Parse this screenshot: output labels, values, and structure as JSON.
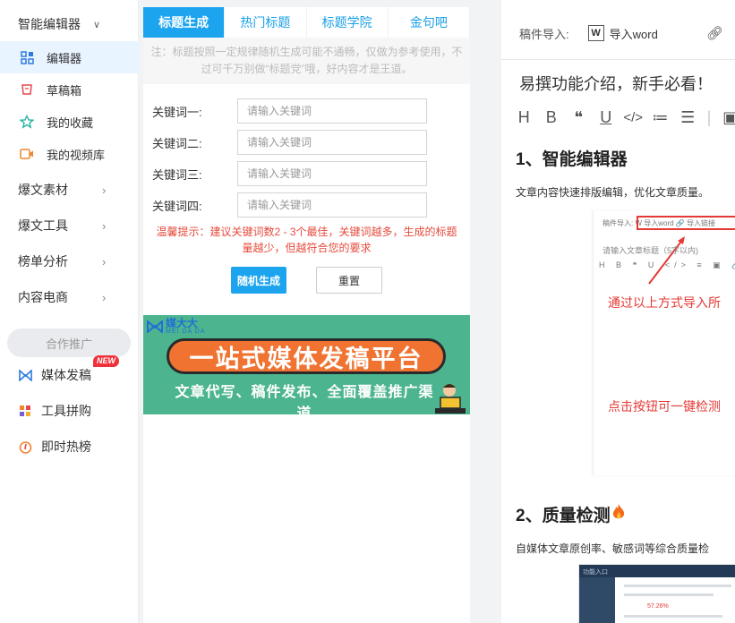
{
  "sidebar": {
    "head": "智能编辑器",
    "items": [
      {
        "label": "编辑器",
        "icon": "grid-icon"
      },
      {
        "label": "草稿箱",
        "icon": "draft-icon"
      },
      {
        "label": "我的收藏",
        "icon": "star-icon"
      },
      {
        "label": "我的视频库",
        "icon": "video-icon"
      }
    ],
    "groups": [
      "爆文素材",
      "爆文工具",
      "榜单分析",
      "内容电商"
    ],
    "promo_label": "合作推广",
    "external": [
      {
        "label": "媒体发稿",
        "icon": "media-icon",
        "badge": "NEW"
      },
      {
        "label": "工具拼购",
        "icon": "tools-icon"
      },
      {
        "label": "即时热榜",
        "icon": "hot-icon"
      }
    ]
  },
  "middle": {
    "tabs": [
      "标题生成",
      "热门标题",
      "标题学院",
      "金句吧"
    ],
    "note": "注：标题按照一定规律随机生成可能不通畅，仅做为参考使用，不过可千万别做“标题党”哦，好内容才是王道。",
    "keywords": [
      {
        "label": "关键词一:",
        "placeholder": "请输入关键词"
      },
      {
        "label": "关键词二:",
        "placeholder": "请输入关键词"
      },
      {
        "label": "关键词三:",
        "placeholder": "请输入关键词"
      },
      {
        "label": "关键词四:",
        "placeholder": "请输入关键词"
      }
    ],
    "tip": "温馨提示：建议关键词数2 - 3个最佳，关键词越多，生成的标题量越少，但越符合您的要求",
    "generate_label": "随机生成",
    "reset_label": "重置",
    "banner": {
      "logo": "媒大大",
      "logo_sub": "MEI DA DA",
      "headline": "一站式媒体发稿平台",
      "subline": "文章代写、稿件发布、全面覆盖推广渠道"
    }
  },
  "editor": {
    "import_label": "稿件导入:",
    "word_label": "导入word",
    "article_title": "易撰功能介绍，新手必看！",
    "toolbar": [
      "H",
      "B",
      "❝",
      "U",
      "</>",
      "≔",
      "☰",
      "|",
      "▣"
    ],
    "section1_title": "1、智能编辑器",
    "section1_text": "文章内容快速排版编辑，优化文章质量。",
    "shot1": {
      "top_text": "稿件导入:  W 导入word     🔗 导入链接",
      "title_hint": "请输入文章标题（5字以内)",
      "toolbar_text": "H B ❝ U </> ≡ ▣ 🔗",
      "callout1": "通过以上方式导入所",
      "callout2": "点击按钮可一键检测"
    },
    "section2_title": "2、质量检测",
    "section2_text": "自媒体文章原创率、敏感词等综合质量检",
    "shot2": {
      "tab": "功能入口",
      "red_value": "57.26%"
    }
  }
}
